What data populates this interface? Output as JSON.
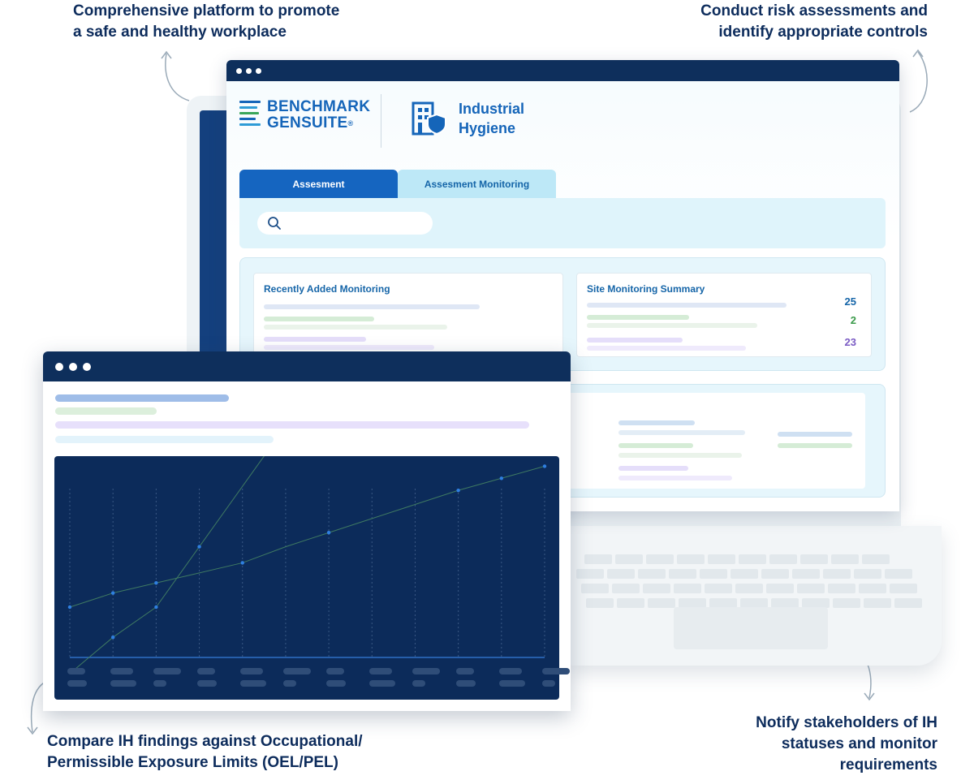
{
  "callouts": {
    "top_left": [
      "Comprehensive platform to promote",
      "a safe and healthy workplace"
    ],
    "top_right": [
      "Conduct risk assessments and",
      "identify appropriate controls"
    ],
    "bottom_left": [
      "Compare IH findings against Occupational/",
      "Permissible Exposure Limits (OEL/PEL)"
    ],
    "bottom_right": [
      "Notify stakeholders of IH",
      "statuses and monitor",
      "requirements"
    ]
  },
  "app": {
    "brand_line1": "BENCHMARK",
    "brand_line2": "GENSUITE",
    "brand_mark": "®",
    "module_line1": "Industrial",
    "module_line2": "Hygiene",
    "module_icon": "building-shield-icon"
  },
  "tabs": [
    {
      "label": "Assesment",
      "active": true
    },
    {
      "label": "Assesment Monitoring",
      "active": false
    }
  ],
  "search": {
    "icon": "search-icon",
    "placeholder": ""
  },
  "cards": {
    "recent": {
      "title": "Recently Added Monitoring"
    },
    "summary": {
      "title": "Site Monitoring Summary",
      "counts": [
        {
          "value": "25",
          "color": "#1565a8"
        },
        {
          "value": "2",
          "color": "#3a9a4a"
        },
        {
          "value": "23",
          "color": "#7b5cc4"
        }
      ]
    }
  },
  "colors": {
    "navy": "#0e2f5c",
    "brand_blue": "#1565c0",
    "chart_bg": "#0c2b5a",
    "line1": "#3f7a62",
    "line2": "#3f7a62",
    "point": "#2f7fe0"
  },
  "chart_data": {
    "type": "line",
    "title": "",
    "xlabel": "",
    "ylabel": "",
    "x": [
      1,
      2,
      3,
      4,
      5,
      6,
      7,
      8,
      9,
      10,
      11,
      12
    ],
    "xlim": [
      1,
      12
    ],
    "ylim": [
      0,
      100
    ],
    "series": [
      {
        "values": [
          25,
          32,
          37,
          42,
          47,
          55,
          62,
          69,
          76,
          83,
          89,
          95
        ],
        "markers": [
          1,
          2,
          3,
          5,
          7,
          10,
          11,
          12
        ]
      },
      {
        "values": [
          -8,
          10,
          25,
          55,
          85,
          115,
          null,
          null,
          null,
          null,
          null,
          null
        ],
        "markers": [
          2,
          3,
          4
        ]
      }
    ],
    "vertical_gridlines": 12,
    "x_tick_labels_rendered_as_placeholders": true
  }
}
